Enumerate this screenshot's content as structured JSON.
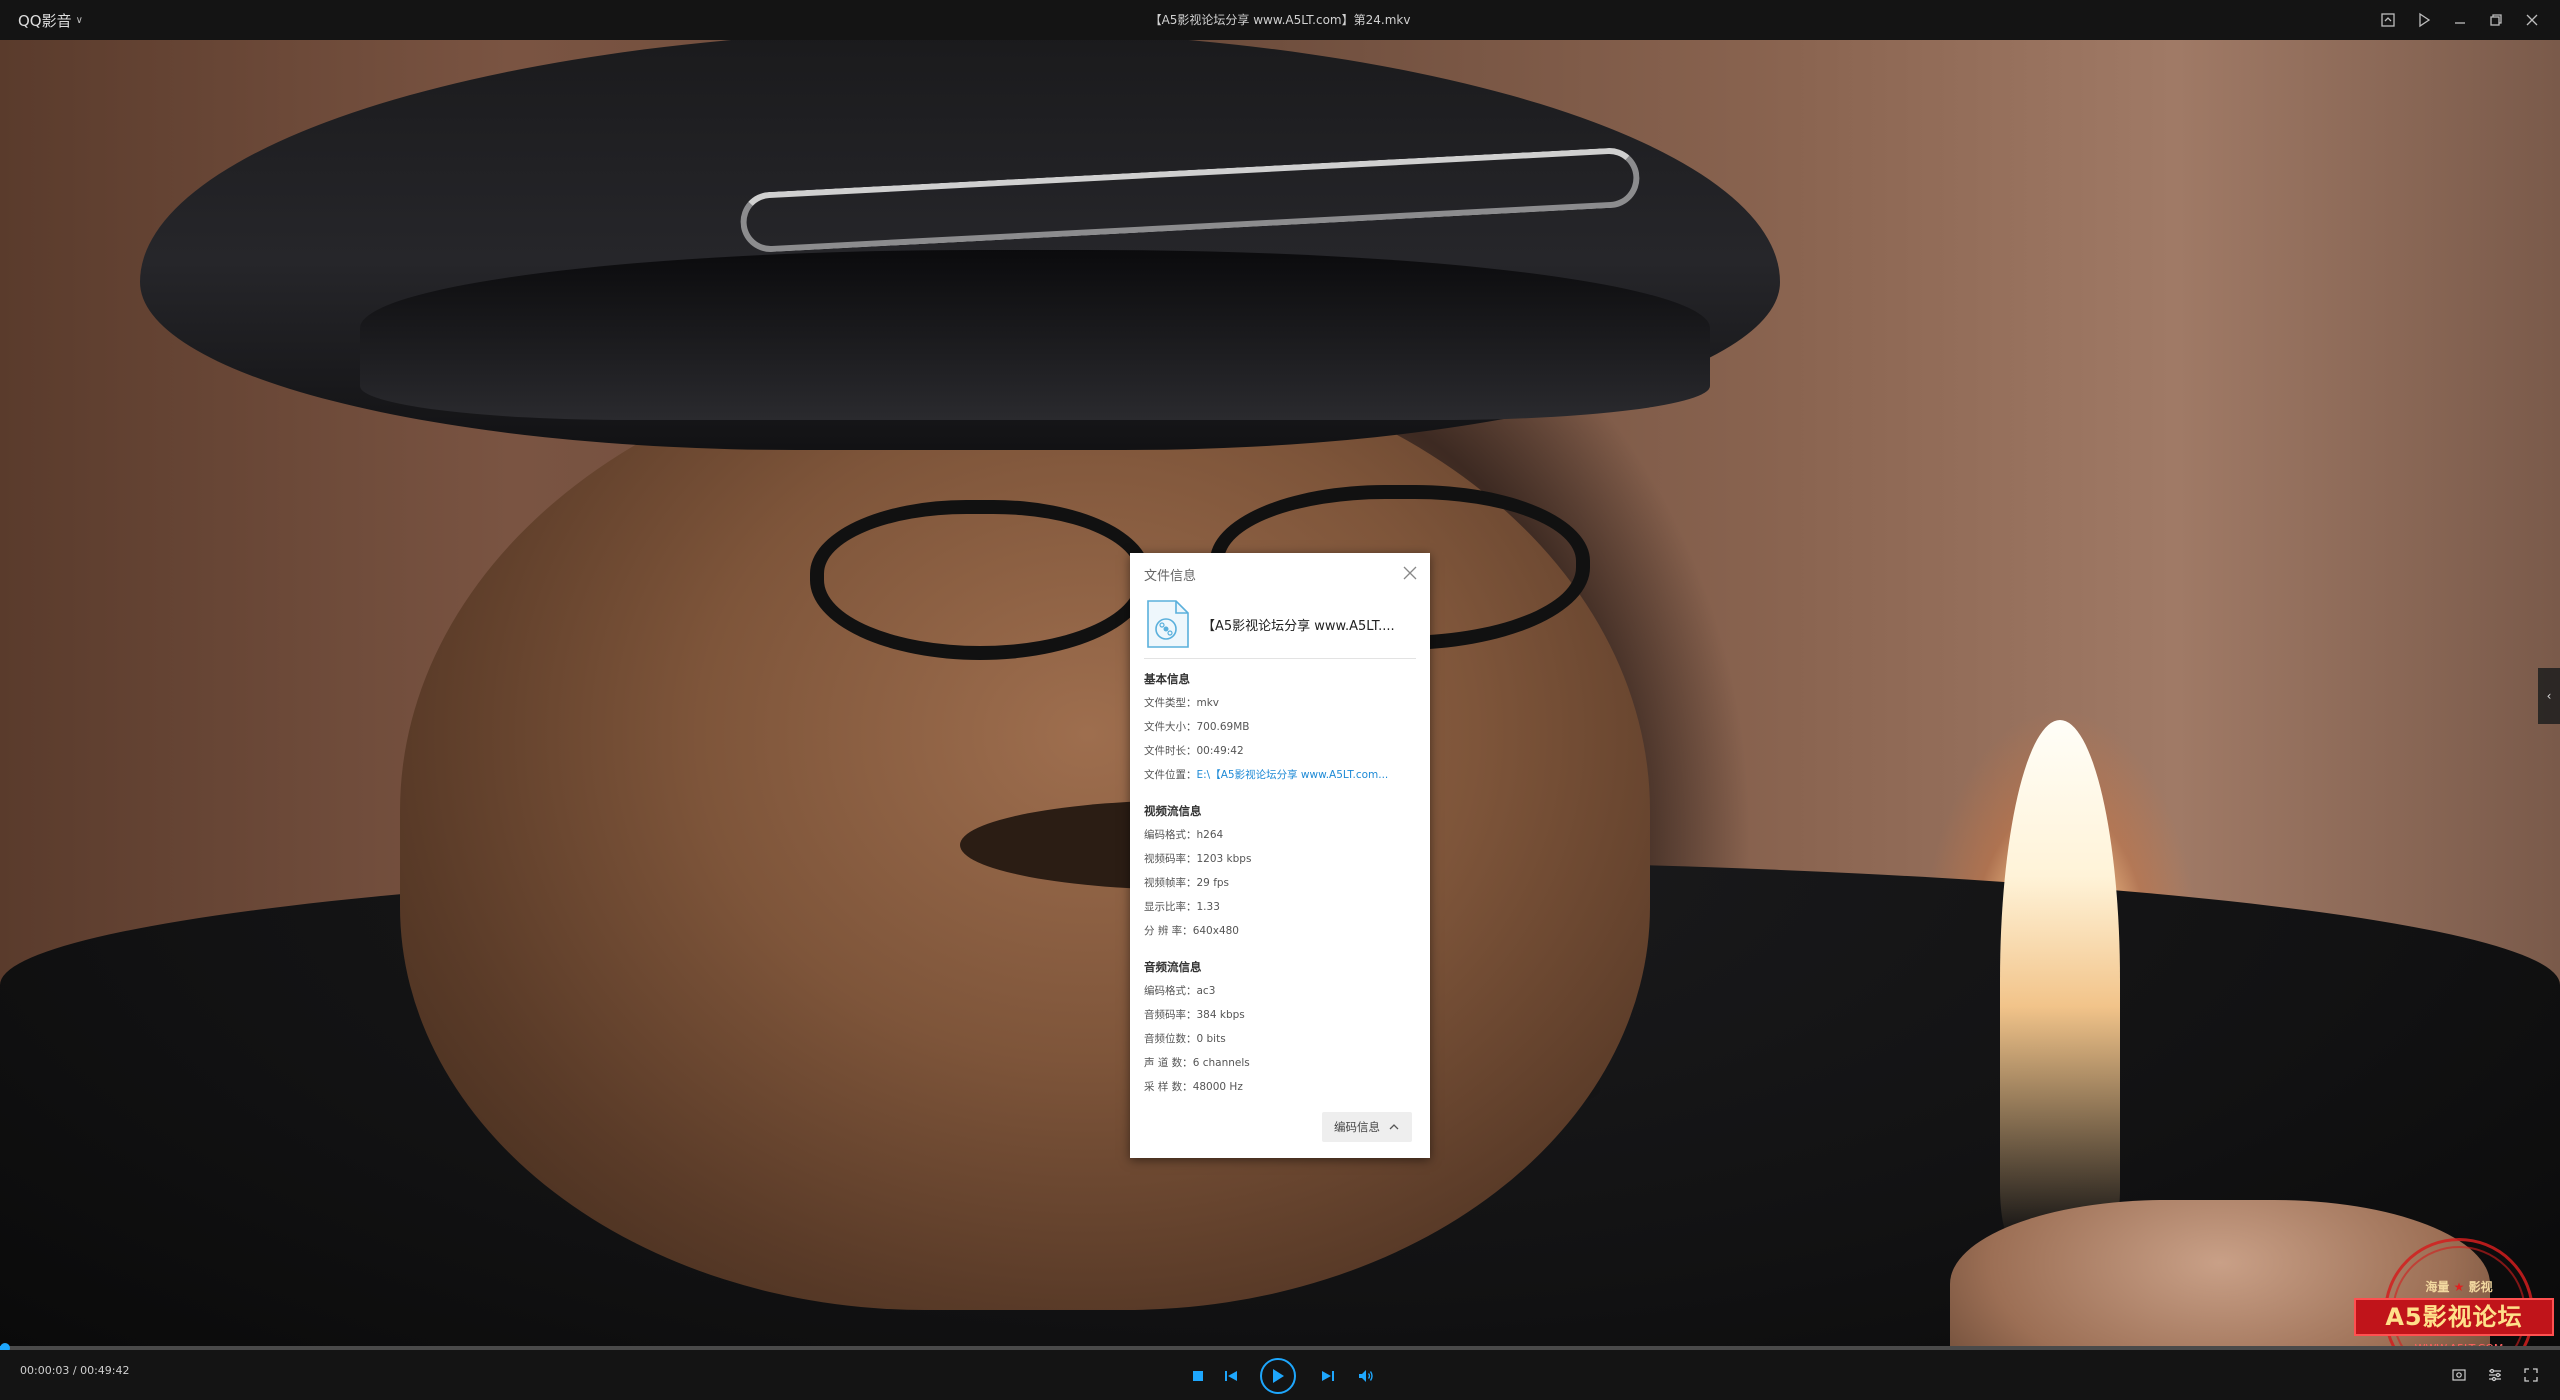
{
  "app": {
    "menu_label": "QQ影音",
    "window_title": "【A5影视论坛分享 www.A5LT.com】第24.mkv"
  },
  "window_controls": [
    {
      "name": "screenshot-button",
      "icon": "screenshot-icon"
    },
    {
      "name": "playlist-button",
      "icon": "playlist-icon"
    },
    {
      "name": "minimize-button",
      "icon": "minimize-icon"
    },
    {
      "name": "restore-button",
      "icon": "restore-icon"
    },
    {
      "name": "close-button",
      "icon": "close-icon"
    }
  ],
  "player": {
    "current_time": "00:00:03",
    "total_time": "00:49:42",
    "time_display": "00:00:03 / 00:49:42",
    "progress_fraction": 0.001,
    "accent_color": "#1ea7fd"
  },
  "watermark": {
    "top_text": "海量",
    "top_text2": "影视",
    "band_text": "A5影视论坛",
    "url": "WWW.A5LT.COM"
  },
  "dialog": {
    "title": "文件信息",
    "file_name": "【A5影视论坛分享 www.A5LT....",
    "basic": {
      "title": "基本信息",
      "rows": [
        {
          "label": "文件类型：",
          "value": "mkv"
        },
        {
          "label": "文件大小：",
          "value": "700.69MB"
        },
        {
          "label": "文件时长：",
          "value": "00:49:42"
        },
        {
          "label": "文件位置：",
          "value": "E:\\【A5影视论坛分享 www.A5LT.com..."
        }
      ]
    },
    "video": {
      "title": "视频流信息",
      "rows": [
        {
          "label": "编码格式：",
          "value": "h264"
        },
        {
          "label": "视频码率：",
          "value": "1203 kbps"
        },
        {
          "label": "视频帧率：",
          "value": "29 fps"
        },
        {
          "label": "显示比率：",
          "value": "1.33"
        },
        {
          "label": "分  辨  率：",
          "value": "640x480"
        }
      ]
    },
    "audio": {
      "title": "音频流信息",
      "rows": [
        {
          "label": "编码格式：",
          "value": "ac3"
        },
        {
          "label": "音频码率：",
          "value": "384 kbps"
        },
        {
          "label": "音频位数：",
          "value": "0 bits"
        },
        {
          "label": "声  道  数：",
          "value": "6 channels"
        },
        {
          "label": "采  样  数：",
          "value": "48000 Hz"
        }
      ]
    },
    "codec_button": "编码信息"
  }
}
